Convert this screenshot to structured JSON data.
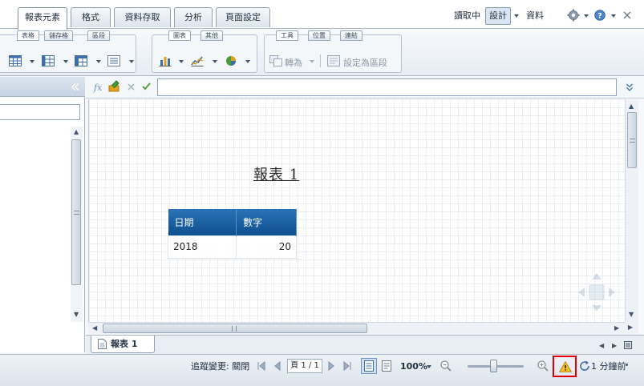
{
  "top_tabs": [
    {
      "label": "報表元素",
      "active": true
    },
    {
      "label": "格式",
      "active": false
    },
    {
      "label": "資料存取",
      "active": false
    },
    {
      "label": "分析",
      "active": false
    },
    {
      "label": "頁面設定",
      "active": false
    }
  ],
  "top_right": {
    "read_label": "讀取中",
    "design_label": "設計",
    "data_label": "資料"
  },
  "ribbon": {
    "group1_tabs": [
      "表格",
      "儲存格",
      "區段"
    ],
    "group2_tabs": [
      "圖表",
      "其他"
    ],
    "group3_tabs": [
      "工具",
      "位置",
      "連結"
    ],
    "convert_label": "轉為",
    "set_section_label": "設定為區段"
  },
  "report": {
    "title": "報表 1",
    "headers": [
      "日期",
      "數字"
    ],
    "rows": [
      [
        "2018",
        "20"
      ]
    ]
  },
  "sheet_tab": {
    "label": "報表 1"
  },
  "status": {
    "track_changes": "追蹤變更: 關閉",
    "page_indicator": "頁 1 / 1",
    "zoom": "100%",
    "last_refresh": "1 分鐘前"
  },
  "colors": {
    "table_header": "#1560a6",
    "warning_highlight": "#e00000",
    "accent": "#7f9bbb"
  },
  "icons": [
    "fx-icon",
    "formula-edit-icon",
    "cancel-icon",
    "confirm-icon",
    "settings-gear-icon",
    "help-icon",
    "close-icon",
    "warning-icon",
    "refresh-icon"
  ]
}
